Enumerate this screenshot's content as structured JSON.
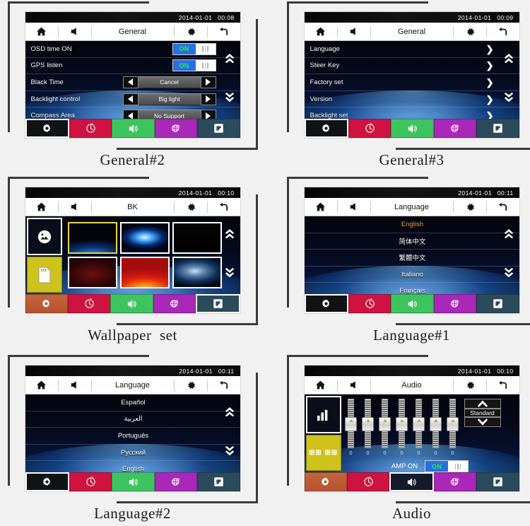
{
  "meta": {
    "background": "#f1f1f1",
    "caption_color": "#1c1c1c",
    "accent_blue": "#2a6fe0",
    "accent_green": "#21f050",
    "accent_gold": "#e8a33d"
  },
  "icons": {
    "home": "home-icon",
    "volume": "volume-icon",
    "gear": "gear-icon",
    "back": "back-icon",
    "up": "chevron-double-up-icon",
    "down": "chevron-double-down-icon",
    "nav_settings": "gear-icon",
    "nav_clock": "clock-icon",
    "nav_audio": "speaker-icon",
    "nav_web": "globe-icon",
    "nav_apps": "apps-icon"
  },
  "navbar": {
    "items": [
      {
        "name": "settings",
        "color": "#111214"
      },
      {
        "name": "clock",
        "color": "#cf1340"
      },
      {
        "name": "audio",
        "color": "#3ec45f"
      },
      {
        "name": "web",
        "color": "#a928b8"
      },
      {
        "name": "apps",
        "color": "#2b4b5c"
      }
    ]
  },
  "panels": [
    {
      "id": "general2",
      "caption": "General#2",
      "status": {
        "date": "2014-01-01",
        "time": "00:08"
      },
      "toolbar": {
        "title": "General"
      },
      "rows": [
        {
          "label": "OSD time ON",
          "type": "toggle",
          "value": "ON"
        },
        {
          "label": "GPS listen",
          "type": "toggle",
          "value": "ON"
        },
        {
          "label": "Black Time",
          "type": "stepper",
          "value": "Cancel"
        },
        {
          "label": "Backlight control",
          "type": "stepper",
          "value": "Big light"
        },
        {
          "label": "Compass Area",
          "type": "stepper",
          "value": "No Support"
        }
      ],
      "active_nav": 0
    },
    {
      "id": "general3",
      "caption": "General#3",
      "status": {
        "date": "2014-01-01",
        "time": "00:09"
      },
      "toolbar": {
        "title": "General"
      },
      "rows": [
        {
          "label": "Language",
          "type": "chevron"
        },
        {
          "label": "Steer Key",
          "type": "chevron"
        },
        {
          "label": "Factory set",
          "type": "chevron"
        },
        {
          "label": "Version",
          "type": "chevron"
        },
        {
          "label": "Backlight set",
          "type": "chevron"
        }
      ],
      "active_nav": 0
    },
    {
      "id": "wallpaper",
      "caption": "Wallpaper  set",
      "status": {
        "date": "2014-01-01",
        "time": "00:10"
      },
      "toolbar": {
        "title": "BK"
      },
      "sources": [
        {
          "name": "internal-wallpaper-source",
          "icon": "picture-icon"
        },
        {
          "name": "sdcard-wallpaper-source",
          "icon": "sdcard-icon"
        }
      ],
      "thumbs": [
        {
          "name": "wallpaper-1",
          "selected": true,
          "style": "blue-horizon"
        },
        {
          "name": "wallpaper-2",
          "selected": false,
          "style": "blue-burst"
        },
        {
          "name": "wallpaper-3",
          "selected": false,
          "style": "black"
        },
        {
          "name": "wallpaper-4",
          "selected": false,
          "style": "dark-red"
        },
        {
          "name": "wallpaper-5",
          "selected": false,
          "style": "red-flare"
        },
        {
          "name": "wallpaper-6",
          "selected": false,
          "style": "blue-mist"
        }
      ],
      "active_nav": 4
    },
    {
      "id": "language1",
      "caption": "Language#1",
      "status": {
        "date": "2014-01-01",
        "time": "00:11"
      },
      "toolbar": {
        "title": "Language"
      },
      "rows": [
        {
          "label": "English",
          "type": "center",
          "selected": true
        },
        {
          "label": "简体中文",
          "type": "center",
          "selected": false
        },
        {
          "label": "繁體中文",
          "type": "center",
          "selected": false
        },
        {
          "label": "Italiano",
          "type": "center",
          "selected": false
        },
        {
          "label": "Français",
          "type": "center",
          "selected": false
        }
      ],
      "active_nav": 0
    },
    {
      "id": "language2",
      "caption": "Language#2",
      "status": {
        "date": "2014-01-01",
        "time": "00:11"
      },
      "toolbar": {
        "title": "Language"
      },
      "rows": [
        {
          "label": "Español",
          "type": "center",
          "selected": false
        },
        {
          "label": "العربية",
          "type": "center",
          "selected": false
        },
        {
          "label": "Português",
          "type": "center",
          "selected": false
        },
        {
          "label": "Русский",
          "type": "center",
          "selected": false
        },
        {
          "label": "English",
          "type": "center",
          "selected": false
        }
      ],
      "active_nav": 0
    },
    {
      "id": "audio",
      "caption": "Audio",
      "status": {
        "date": "2014-01-01",
        "time": "00:10"
      },
      "toolbar": {
        "title": "Audio"
      },
      "modes": [
        {
          "name": "equalizer-mode",
          "icon": "bars-icon"
        },
        {
          "name": "balance-mode",
          "label": "⊞⊞\n⊞⊞"
        }
      ],
      "equalizer": {
        "bands": [
          {
            "name": "band-1",
            "value": "0"
          },
          {
            "name": "band-2",
            "value": "0"
          },
          {
            "name": "band-3",
            "value": "0"
          },
          {
            "name": "band-4",
            "value": "0"
          },
          {
            "name": "band-5",
            "value": "0"
          },
          {
            "name": "band-6",
            "value": "0"
          },
          {
            "name": "band-7",
            "value": "0"
          }
        ],
        "preset": "Standard"
      },
      "amp": {
        "label": "AMP ON",
        "value": "ON"
      },
      "active_nav": 2
    }
  ]
}
